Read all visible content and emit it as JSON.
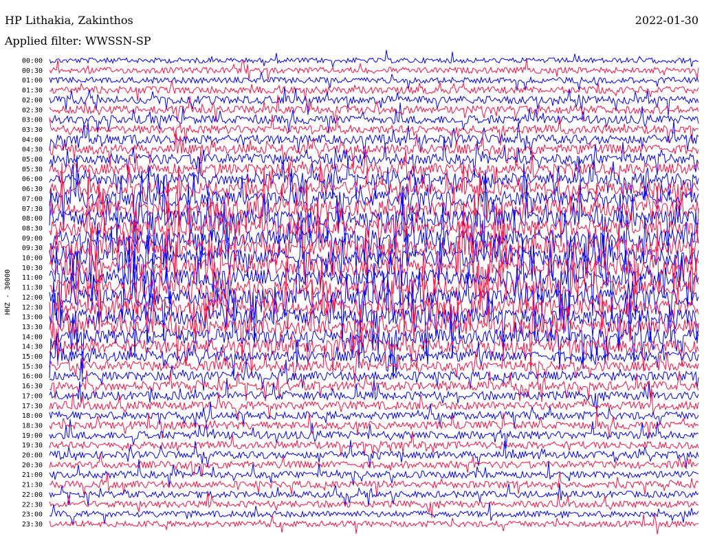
{
  "header": {
    "station": "HP Lithakia, Zakinthos",
    "filter": "Applied filter: WWSSN-SP",
    "date": "2022-01-30"
  },
  "chart_data": {
    "type": "line",
    "title": "HP Lithakia, Zakinthos",
    "subtitle": "Applied filter: WWSSN-SP",
    "date": "2022-01-30",
    "ylabel": "HHZ - 30000",
    "xlabel": "",
    "row_labels": [
      "00:00",
      "00:30",
      "01:00",
      "01:30",
      "02:00",
      "02:30",
      "03:00",
      "03:30",
      "04:00",
      "04:30",
      "05:00",
      "05:30",
      "06:00",
      "06:30",
      "07:00",
      "07:30",
      "08:00",
      "08:30",
      "09:00",
      "09:30",
      "10:00",
      "10:30",
      "11:00",
      "11:30",
      "12:00",
      "12:30",
      "13:00",
      "13:30",
      "14:00",
      "14:30",
      "15:00",
      "15:30",
      "16:00",
      "16:30",
      "17:00",
      "17:30",
      "18:00",
      "18:30",
      "19:00",
      "19:30",
      "20:00",
      "20:30",
      "21:00",
      "21:30",
      "22:00",
      "22:30",
      "23:00",
      "23:30"
    ],
    "row_activity": [
      0.15,
      0.2,
      0.2,
      0.3,
      0.35,
      0.35,
      0.4,
      0.4,
      0.45,
      0.5,
      0.55,
      0.6,
      0.7,
      0.8,
      0.9,
      1.0,
      1.0,
      1.0,
      1.0,
      1.0,
      1.0,
      1.0,
      1.0,
      1.0,
      1.0,
      1.0,
      1.0,
      0.95,
      0.9,
      0.8,
      0.55,
      0.5,
      0.45,
      0.45,
      0.4,
      0.4,
      0.35,
      0.35,
      0.35,
      0.3,
      0.3,
      0.3,
      0.28,
      0.28,
      0.25,
      0.25,
      0.22,
      0.2
    ],
    "colors": [
      "#0000ff",
      "#ff1040"
    ],
    "grid": false,
    "legend": "none"
  }
}
